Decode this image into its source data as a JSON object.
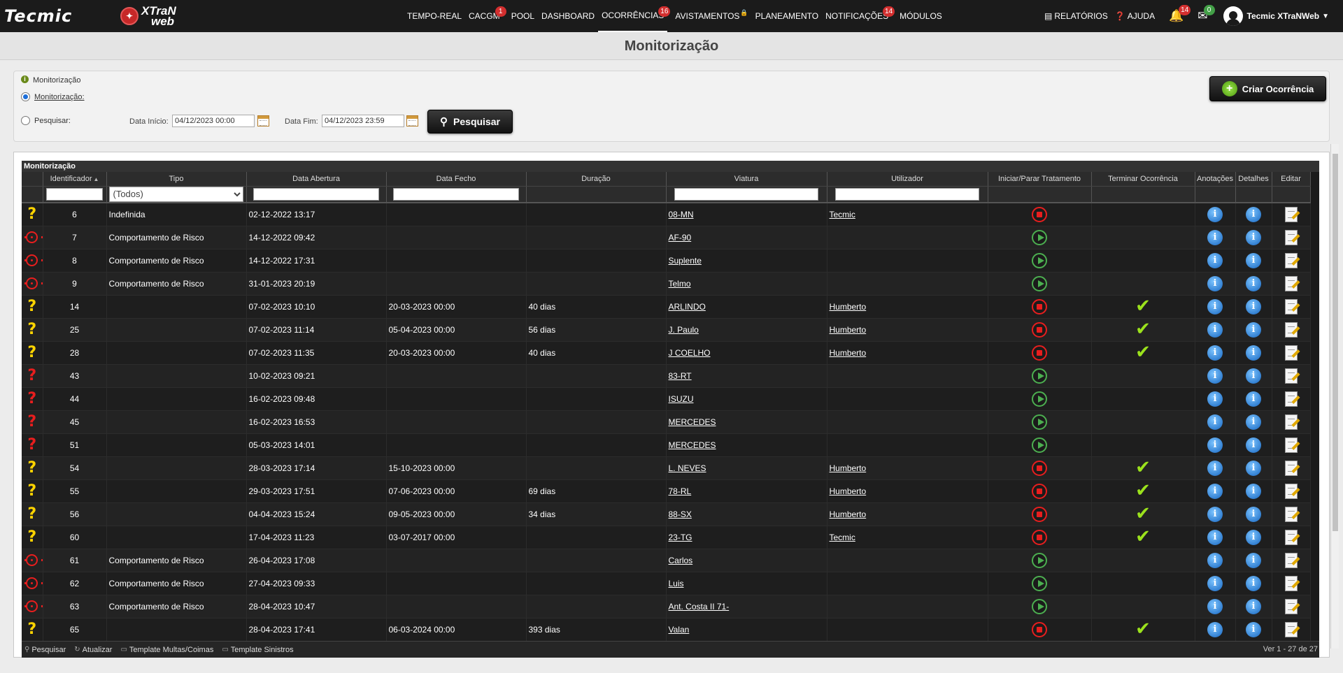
{
  "brand": {
    "tecmic": "Tecmic",
    "xtran_line1": "XTraN",
    "xtran_line2": "web"
  },
  "nav": {
    "items": [
      {
        "label": "TEMPO-REAL",
        "badge": ""
      },
      {
        "label": "CACGM",
        "badge": "1"
      },
      {
        "label": "POOL",
        "badge": ""
      },
      {
        "label": "DASHBOARD",
        "badge": ""
      },
      {
        "label": "OCORRÊNCIAS",
        "badge": "16"
      },
      {
        "label": "AVISTAMENTOS",
        "badge": ""
      },
      {
        "label": "PLANEAMENTO",
        "badge": ""
      },
      {
        "label": "NOTIFICAÇÕES",
        "badge": "14"
      },
      {
        "label": "MÓDULOS",
        "badge": ""
      }
    ],
    "reports": "RELATÓRIOS",
    "help": "AJUDA",
    "bell_badge": "14",
    "mail_badge": "0",
    "user": "Tecmic XTraNWeb"
  },
  "page_title": "Monitorização",
  "filters": {
    "section_label": "Monitorização",
    "radio_monitor": "Monitorização:",
    "radio_search": "Pesquisar:",
    "start_label": "Data Início:",
    "start_value": "04/12/2023 00:00",
    "end_label": "Data Fim:",
    "end_value": "04/12/2023 23:59",
    "search_button": "Pesquisar",
    "create_button": "Criar Ocorrência"
  },
  "grid": {
    "caption": "Monitorização",
    "columns": [
      "",
      "Identificador",
      "Tipo",
      "Data Abertura",
      "Data Fecho",
      "Duração",
      "Viatura",
      "Utilizador",
      "Iniciar/Parar Tratamento",
      "Terminar Ocorrência",
      "Anotações",
      "Detalhes",
      "Editar"
    ],
    "tipo_filter": "(Todos)",
    "rows": [
      {
        "status": "q-yellow",
        "id": "6",
        "tipo": "Indefinida",
        "abertura": "02-12-2022 13:17",
        "fecho": "",
        "duracao": "",
        "viatura": "08-MN",
        "utilizador": "Tecmic",
        "action": "stop",
        "terminar": false
      },
      {
        "status": "target",
        "id": "7",
        "tipo": "Comportamento de Risco",
        "abertura": "14-12-2022 09:42",
        "fecho": "",
        "duracao": "",
        "viatura": "AF-90",
        "utilizador": "",
        "action": "play",
        "terminar": false
      },
      {
        "status": "target",
        "id": "8",
        "tipo": "Comportamento de Risco",
        "abertura": "14-12-2022 17:31",
        "fecho": "",
        "duracao": "",
        "viatura": "Suplente",
        "utilizador": "",
        "action": "play",
        "terminar": false
      },
      {
        "status": "target",
        "id": "9",
        "tipo": "Comportamento de Risco",
        "abertura": "31-01-2023 20:19",
        "fecho": "",
        "duracao": "",
        "viatura": "Telmo",
        "utilizador": "",
        "action": "play",
        "terminar": false
      },
      {
        "status": "q-yellow",
        "id": "14",
        "tipo": "",
        "abertura": "07-02-2023 10:10",
        "fecho": "20-03-2023 00:00",
        "duracao": "40 dias",
        "viatura": "ARLINDO",
        "utilizador": "Humberto",
        "action": "stop",
        "terminar": true
      },
      {
        "status": "q-yellow",
        "id": "25",
        "tipo": "",
        "abertura": "07-02-2023 11:14",
        "fecho": "05-04-2023 00:00",
        "duracao": "56 dias",
        "viatura": "J. Paulo",
        "utilizador": "Humberto",
        "action": "stop",
        "terminar": true
      },
      {
        "status": "q-yellow",
        "id": "28",
        "tipo": "",
        "abertura": "07-02-2023 11:35",
        "fecho": "20-03-2023 00:00",
        "duracao": "40 dias",
        "viatura": "J COELHO",
        "utilizador": "Humberto",
        "action": "stop",
        "terminar": true
      },
      {
        "status": "q-red",
        "id": "43",
        "tipo": "",
        "abertura": "10-02-2023 09:21",
        "fecho": "",
        "duracao": "",
        "viatura": "83-RT",
        "utilizador": "",
        "action": "play",
        "terminar": false
      },
      {
        "status": "q-red",
        "id": "44",
        "tipo": "",
        "abertura": "16-02-2023 09:48",
        "fecho": "",
        "duracao": "",
        "viatura": "ISUZU",
        "utilizador": "",
        "action": "play",
        "terminar": false
      },
      {
        "status": "q-red",
        "id": "45",
        "tipo": "",
        "abertura": "16-02-2023 16:53",
        "fecho": "",
        "duracao": "",
        "viatura": "MERCEDES",
        "utilizador": "",
        "action": "play",
        "terminar": false
      },
      {
        "status": "q-red",
        "id": "51",
        "tipo": "",
        "abertura": "05-03-2023 14:01",
        "fecho": "",
        "duracao": "",
        "viatura": "MERCEDES",
        "utilizador": "",
        "action": "play",
        "terminar": false
      },
      {
        "status": "q-yellow",
        "id": "54",
        "tipo": "",
        "abertura": "28-03-2023 17:14",
        "fecho": "15-10-2023 00:00",
        "duracao": "",
        "viatura": "L. NEVES",
        "utilizador": "Humberto",
        "action": "stop",
        "terminar": true
      },
      {
        "status": "q-yellow",
        "id": "55",
        "tipo": "",
        "abertura": "29-03-2023 17:51",
        "fecho": "07-06-2023 00:00",
        "duracao": "69 dias",
        "viatura": "78-RL",
        "utilizador": "Humberto",
        "action": "stop",
        "terminar": true
      },
      {
        "status": "q-yellow",
        "id": "56",
        "tipo": "",
        "abertura": "04-04-2023 15:24",
        "fecho": "09-05-2023 00:00",
        "duracao": "34 dias",
        "viatura": "88-SX",
        "utilizador": "Humberto",
        "action": "stop",
        "terminar": true
      },
      {
        "status": "q-yellow",
        "id": "60",
        "tipo": "",
        "abertura": "17-04-2023 11:23",
        "fecho": "03-07-2017 00:00",
        "duracao": "",
        "viatura": "23-TG",
        "utilizador": "Tecmic",
        "action": "stop",
        "terminar": true
      },
      {
        "status": "target",
        "id": "61",
        "tipo": "Comportamento de Risco",
        "abertura": "26-04-2023 17:08",
        "fecho": "",
        "duracao": "",
        "viatura": "Carlos",
        "utilizador": "",
        "action": "play",
        "terminar": false
      },
      {
        "status": "target",
        "id": "62",
        "tipo": "Comportamento de Risco",
        "abertura": "27-04-2023 09:33",
        "fecho": "",
        "duracao": "",
        "viatura": "Luis",
        "utilizador": "",
        "action": "play",
        "terminar": false
      },
      {
        "status": "target",
        "id": "63",
        "tipo": "Comportamento de Risco",
        "abertura": "28-04-2023 10:47",
        "fecho": "",
        "duracao": "",
        "viatura": "Ant. Costa II 71-",
        "utilizador": "",
        "action": "play",
        "terminar": false
      },
      {
        "status": "q-yellow",
        "id": "65",
        "tipo": "",
        "abertura": "28-04-2023 17:41",
        "fecho": "06-03-2024 00:00",
        "duracao": "393 dias",
        "viatura": "Valan",
        "utilizador": "",
        "action": "stop",
        "terminar": true
      }
    ]
  },
  "footer": {
    "search": "Pesquisar",
    "refresh": "Atualizar",
    "template_fines": "Template Multas/Coimas",
    "template_claims": "Template Sinistros",
    "pager": "Ver 1 - 27 de 27"
  }
}
